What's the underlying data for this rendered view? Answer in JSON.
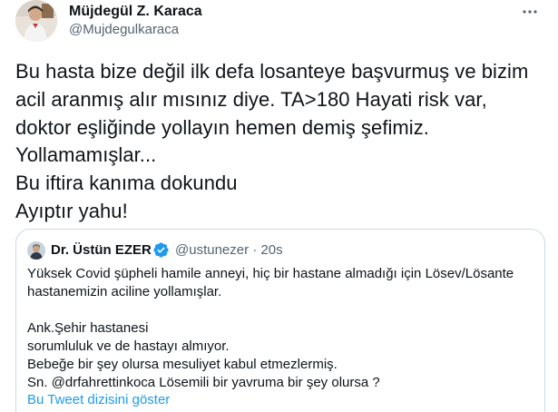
{
  "author": {
    "display_name": "Müjdegül Z. Karaca",
    "handle": "@Mujdegulkaraca",
    "avatar_icon": "profile-photo-icon"
  },
  "menu": {
    "icon": "more-options-icon"
  },
  "tweet": {
    "lines": [
      "Bu hasta bize değil ilk defa losanteye başvurmuş ve bizim",
      "acil aranmış alır mısınız diye. TA>180 Hayati risk var,",
      "doktor eşliğinde yollayın hemen demiş şefimiz.",
      "Yollamamışlar...",
      "Bu iftira kanıma dokundu",
      "Ayıptır yahu!"
    ]
  },
  "quoted": {
    "display_name": "Dr. Üstün EZER",
    "verified_icon": "verified-badge-icon",
    "handle_time": "@ustunezer · 20s",
    "lines": [
      "Yüksek Covid şüpheli hamile anneyi, hiç bir hastane almadığı için Lösev/Lösante",
      "hastanemizin aciline yollamışlar.",
      "",
      "Ank.Şehir hastanesi",
      "sorumluluk ve de hastayı almıyor.",
      "Bebeğe bir şey olursa mesuliyet kabul etmezlermiş.",
      "Sn. @drfahrettinkoca Lösemili bir yavruma bir şey olursa ?"
    ],
    "show_thread": "Bu Tweet dizisini göster"
  },
  "colors": {
    "text": "#0f1419",
    "secondary": "#536471",
    "link": "#1d9bf0",
    "border": "#cfd9de"
  }
}
